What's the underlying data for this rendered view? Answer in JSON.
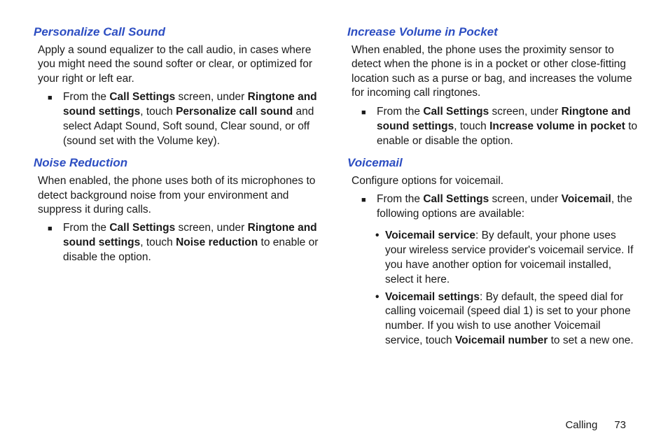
{
  "left": {
    "s1": {
      "heading": "Personalize Call Sound",
      "para": "Apply a sound equalizer to the call audio, in cases where you might need the sound softer or clear, or optimized for your right or left ear.",
      "step_pre": "From the ",
      "step_b1": "Call Settings",
      "step_mid1": " screen, under ",
      "step_b2": "Ringtone and sound settings",
      "step_mid2": ", touch ",
      "step_b3": "Personalize call sound",
      "step_post": " and select Adapt Sound, Soft sound, Clear sound, or off (sound set with the Volume key)."
    },
    "s2": {
      "heading": "Noise Reduction",
      "para": "When enabled, the phone uses both of its microphones to detect background noise from your environment and suppress it during calls.",
      "step_pre": "From the ",
      "step_b1": "Call Settings",
      "step_mid1": " screen, under ",
      "step_b2": "Ringtone and sound settings",
      "step_mid2": ", touch ",
      "step_b3": "Noise reduction",
      "step_post": " to enable or disable the option."
    }
  },
  "right": {
    "s1": {
      "heading": "Increase Volume in Pocket",
      "para": "When enabled, the phone uses the proximity sensor to detect when the phone is in a pocket or other close-fitting location such as a purse or bag, and increases the volume for incoming call ringtones.",
      "step_pre": "From the ",
      "step_b1": "Call Settings",
      "step_mid1": " screen, under ",
      "step_b2": "Ringtone and sound settings",
      "step_mid2": ", touch ",
      "step_b3": "Increase volume in pocket",
      "step_post": " to enable or disable the option."
    },
    "s2": {
      "heading": "Voicemail",
      "para": "Configure options for voicemail.",
      "step_pre": "From the ",
      "step_b1": "Call Settings",
      "step_mid1": " screen, under ",
      "step_b2": "Voicemail",
      "step_post": ", the following options are available:",
      "sub1_b": "Voicemail service",
      "sub1_t": ": By default, your phone uses your wireless service provider's voicemail service. If you have another option for voicemail installed, select it here.",
      "sub2_b": "Voicemail settings",
      "sub2_t1": ": By default, the speed dial for calling voicemail (speed dial 1) is set to your phone number. If you wish to use another Voicemail service, touch ",
      "sub2_b2": "Voicemail number",
      "sub2_t2": " to set a new one."
    }
  },
  "footer": {
    "section": "Calling",
    "page": "73"
  }
}
